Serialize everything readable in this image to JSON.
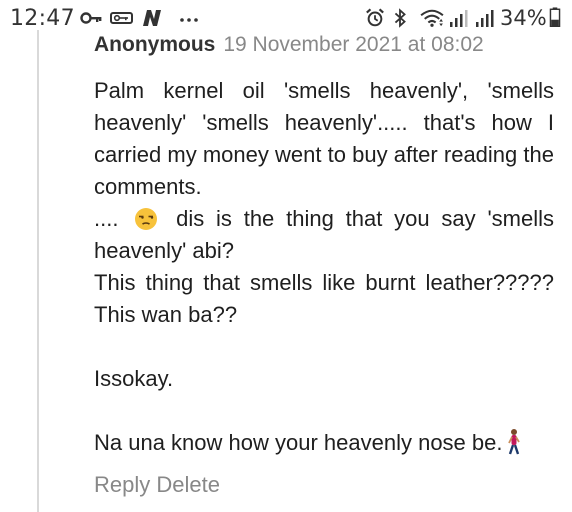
{
  "status_bar": {
    "time": "12:47",
    "battery_percent": "34%",
    "icons": [
      "key-icon",
      "vpn-key-icon",
      "n-app-icon",
      "more-notifications-icon",
      "alarm-icon",
      "bluetooth-icon",
      "wifi-icon",
      "signal-icon",
      "signal-icon",
      "battery-icon"
    ]
  },
  "comment": {
    "author": "Anonymous",
    "date": "19 November 2021 at 08:02",
    "lines": {
      "p1": "Palm kernel oil 'smells heavenly', 'smells heavenly' 'smells heavenly'..... that's how I carried my money went to buy after reading the comments.",
      "p2_prefix": "....",
      "p2_rest": "dis is the thing that you say 'smells heavenly' abi?",
      "p3": "This thing that smells like burnt leather????? This wan ba??",
      "p4": "Issokay.",
      "p5": "Na una know how your heavenly nose be."
    },
    "emojis": [
      "unamused-face-emoji",
      "woman-walking-emoji"
    ]
  },
  "actions": {
    "reply": "Reply",
    "delete": "Delete"
  },
  "colors": {
    "text": "#1f1f1f",
    "meta": "#888888",
    "border": "#d9d9d9"
  }
}
